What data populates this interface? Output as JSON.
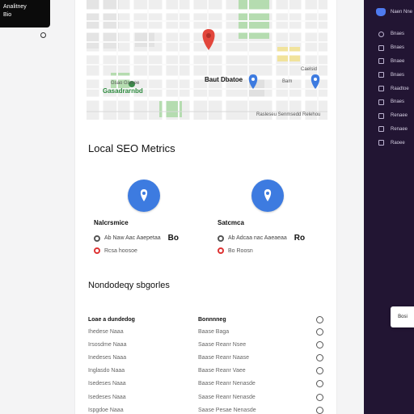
{
  "top_badge": {
    "line1": "Analitney",
    "line2": "Bio"
  },
  "map": {
    "labels": [
      {
        "text": "Baut Dbatoe",
        "color": "#2d8a3e"
      },
      {
        "text": "Gasadrarnbd",
        "color": "#2d8a3e"
      },
      {
        "text": "Bam",
        "color": "#555555"
      },
      {
        "text": "Caelsid",
        "color": "#555555"
      },
      {
        "text": "Gsao Gsmee",
        "color": "#555555"
      }
    ],
    "footer": "Rasleseu Senmsedd Relehou",
    "colors": {
      "park": "#b5dcb0",
      "pin_red": "#e2463b",
      "pin_blue": "#3d7be0",
      "block": "#f1e39c"
    }
  },
  "local_seo": {
    "title": "Local SEO Metrics",
    "metrics": [
      {
        "title": "Nalcrsmice",
        "row1_text": "Ab Naw Aac Aaepetaa",
        "row1_value": "Bo",
        "row2_text": "Rcsa hoosoe"
      },
      {
        "title": "Satcmca",
        "row1_text": "Ab Adcaa nac Aaeaeaa",
        "row1_value": "Ro",
        "row2_text": "Bo Roosn"
      }
    ]
  },
  "second_section": {
    "title": "Nondodeqy sbgorles",
    "table": {
      "headers": [
        "Loae a dundedog",
        "Bonnnneg"
      ],
      "rows": [
        [
          "Ihedese Naaa",
          "Baase Baga"
        ],
        [
          "Irsosdme Naaa",
          "Saase Reanr Nsee"
        ],
        [
          "Inedeses Naaa",
          "Baase Reanr Naase"
        ],
        [
          "Inglasdo Naaa",
          "Baase Reanr Vaee"
        ],
        [
          "Isedeses Naaa",
          "Baase Reanr Nenasde"
        ],
        [
          "Isedeses Naaa",
          "Saase Reanr Nenasde"
        ],
        [
          "Ispgdoe Naaa",
          "Saase Pesae Nenasde"
        ]
      ]
    }
  },
  "sidebar": {
    "header": "Naen Nne",
    "items": [
      "Bnaes",
      "Bnaes",
      "Bnaee",
      "Bnaes",
      "Raadtoe",
      "Bnaes",
      "Renaee",
      "Renaee",
      "Raoee"
    ],
    "colors": {
      "bg": "#221533",
      "logo": "#4f7bf0"
    }
  },
  "floating_button": "Bosi"
}
